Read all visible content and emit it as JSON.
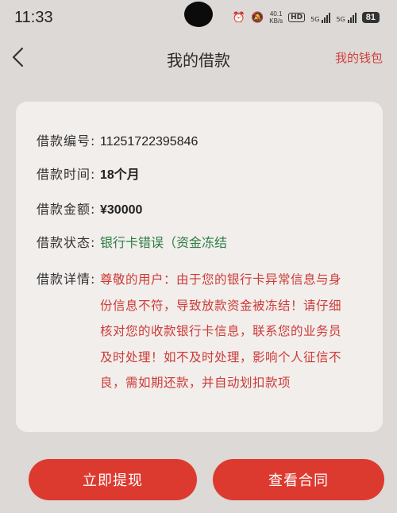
{
  "status_bar": {
    "time": "11:33",
    "speed_value": "40.1",
    "speed_unit": "KB/s",
    "hd": "HD",
    "sim1": "5G",
    "sim2": "5G",
    "battery": "81"
  },
  "nav": {
    "title": "我的借款",
    "wallet_link": "我的钱包"
  },
  "loan": {
    "number_label": "借款编号:",
    "number_value": "11251722395846",
    "term_label": "借款时间:",
    "term_value": "18个月",
    "amount_label": "借款金额:",
    "amount_value": "¥30000",
    "status_label": "借款状态:",
    "status_value": "银行卡错误（资金冻结",
    "detail_label": "借款详情:",
    "detail_value": "尊敬的用户：由于您的银行卡异常信息与身份信息不符，导致放款资金被冻结！请仔细核对您的收款银行卡信息，联系您的业务员及时处理！如不及时处理，影响个人征信不良，需如期还款，并自动划扣款项"
  },
  "actions": {
    "withdraw": "立即提现",
    "contract": "查看合同"
  },
  "colors": {
    "accent": "#dd3a2f",
    "detail_text": "#cc3b36",
    "status_green": "#2f7d44"
  }
}
